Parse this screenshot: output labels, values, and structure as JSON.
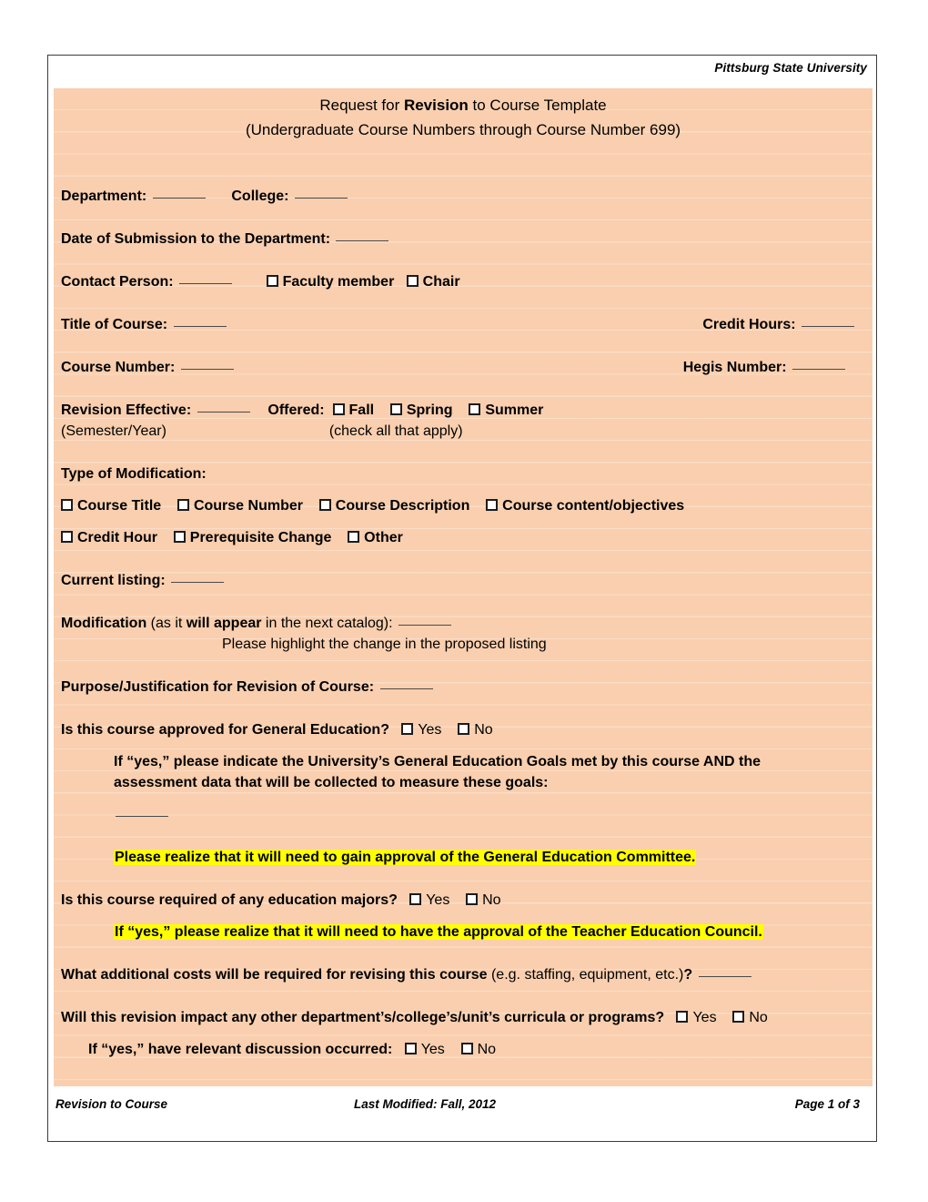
{
  "document": {
    "university": "Pittsburg State University",
    "title_line_1_pre": "Request for ",
    "title_line_1_bold": "Revision",
    "title_line_1_post": " to Course Template",
    "title_line_2": "(Undergraduate Course Numbers through Course Number 699)",
    "blank_field": "_____"
  },
  "fields": {
    "department_label": "Department",
    "college_label": "College",
    "date_of_submission_label": "Date of Submission to the Department",
    "contact_person_label": "Contact Person:",
    "faculty_member_label": "Faculty member",
    "chair_label": "Chair",
    "title_of_course_label": "Title of Course",
    "credit_hours_label": "Credit Hours",
    "course_number_label": "Course Number",
    "hegis_number_label": "Hegis Number",
    "revision_effective_label": "Revision Effective",
    "offered_label": "Offered",
    "offered_fall": "Fall",
    "offered_spring": "Spring",
    "offered_summer": "Summer",
    "semester_year_note": "(Semester/Year)",
    "check_all_note": "(check all that apply)",
    "current_listing_label": "Current listing:"
  },
  "modification": {
    "heading": "Type of Modification",
    "options_row1": [
      "Course Title",
      "Course Number",
      "Course Description",
      "Course content/objectives"
    ],
    "options_row2": [
      "Credit Hour",
      "Prerequisite Change",
      "Other"
    ],
    "mod_bold_1": "Modification",
    "mod_reg_1": " (as it ",
    "mod_bold_2": "will appear",
    "mod_reg_2": " in the next catalog):",
    "highlight_note": "Please highlight the change in the proposed listing",
    "purpose_label": "Purpose/Justification for Revision of Course"
  },
  "gened": {
    "question": "Is this course approved for General Education?",
    "yes_label": "Yes",
    "no_label": "No",
    "if_yes_line_1": "If  “yes,” please indicate the University’s General Education Goals met by this course AND the",
    "if_yes_line_2": "assessment data that will be collected to measure these goals:",
    "warning": "Please realize that it will need to gain approval of the General Education Committee."
  },
  "education_majors": {
    "question": "Is this course required of any education majors?",
    "yes_label": "Yes",
    "no_label": "No",
    "warning": "If “yes,” please realize that it will need to have the approval of the Teacher Education Council."
  },
  "costs": {
    "question_bold_1": "What additional costs will be required for revising this course",
    "question_reg": " (e.g. staffing, equipment, etc.)",
    "question_bold_2": "?"
  },
  "impact": {
    "question": "Will this revision impact any other department’s/college’s/unit’s curricula or programs?",
    "yes_label": "Yes",
    "no_label": "No",
    "followup": "If “yes,” have relevant discussion occurred:",
    "followup_yes": "Yes",
    "followup_no": "No"
  },
  "footer": {
    "left": "Revision to Course",
    "middle": "Last Modified:  Fall, 2012",
    "right": "Page 1 of 3"
  },
  "colors": {
    "page_background": "#f9cfaf",
    "highlight": "#ffff00",
    "border": "#3b3b3b",
    "text": "#000000"
  }
}
